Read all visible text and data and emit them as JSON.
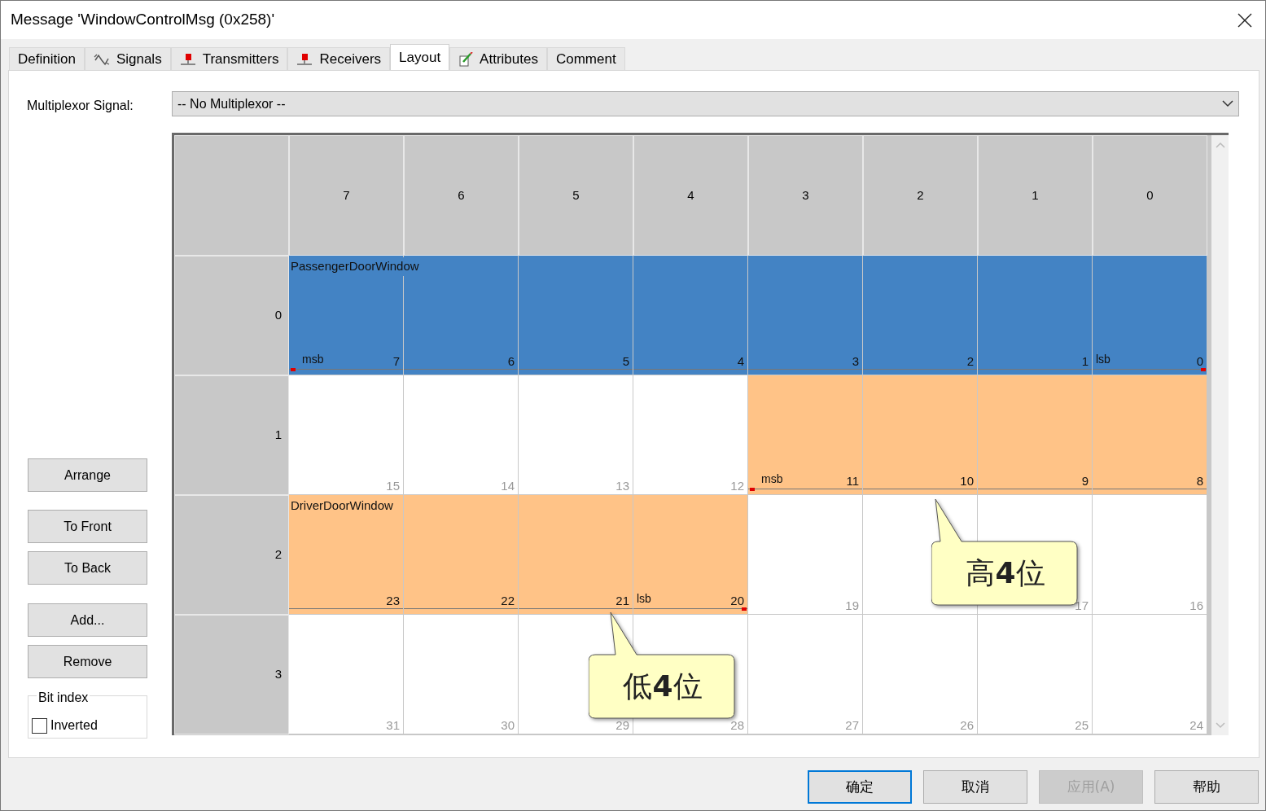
{
  "window": {
    "title": "Message 'WindowControlMsg (0x258)'"
  },
  "tabs": [
    {
      "label": "Definition",
      "kind": "plain",
      "selected": false
    },
    {
      "label": "Signals",
      "kind": "wave",
      "selected": false
    },
    {
      "label": "Transmitters",
      "kind": "node",
      "selected": false
    },
    {
      "label": "Receivers",
      "kind": "node",
      "selected": false
    },
    {
      "label": "Layout",
      "kind": "plain",
      "selected": true
    },
    {
      "label": "Attributes",
      "kind": "pencil",
      "selected": false
    },
    {
      "label": "Comment",
      "kind": "plain",
      "selected": false
    }
  ],
  "multiplexor": {
    "label": "Multiplexor Signal:",
    "value": "-- No Multiplexor --"
  },
  "side_buttons": [
    "Arrange",
    "To Front",
    "To Back",
    "Add...",
    "Remove"
  ],
  "bit_index": {
    "title": "Bit index",
    "inverted": {
      "label": "Inverted",
      "checked": false
    }
  },
  "columns": [
    "7",
    "6",
    "5",
    "4",
    "3",
    "2",
    "1",
    "0"
  ],
  "rows": [
    {
      "label": "0",
      "cells": [
        {
          "bit": "7",
          "color": "#4383c4",
          "name": "PassengerDoorWindow",
          "tag": "msb"
        },
        {
          "bit": "6",
          "color": "#4383c4"
        },
        {
          "bit": "5",
          "color": "#4383c4"
        },
        {
          "bit": "4",
          "color": "#4383c4"
        },
        {
          "bit": "3",
          "color": "#4383c4"
        },
        {
          "bit": "2",
          "color": "#4383c4"
        },
        {
          "bit": "1",
          "color": "#4383c4"
        },
        {
          "bit": "0",
          "color": "#4383c4",
          "tag": "lsb"
        }
      ]
    },
    {
      "label": "1",
      "cells": [
        {
          "bit": "15"
        },
        {
          "bit": "14"
        },
        {
          "bit": "13"
        },
        {
          "bit": "12"
        },
        {
          "bit": "11",
          "color": "#ffc387",
          "tag": "msb"
        },
        {
          "bit": "10",
          "color": "#ffc387"
        },
        {
          "bit": "9",
          "color": "#ffc387"
        },
        {
          "bit": "8",
          "color": "#ffc387"
        }
      ]
    },
    {
      "label": "2",
      "cells": [
        {
          "bit": "23",
          "color": "#ffc387",
          "name": "DriverDoorWindow"
        },
        {
          "bit": "22",
          "color": "#ffc387"
        },
        {
          "bit": "21",
          "color": "#ffc387"
        },
        {
          "bit": "20",
          "color": "#ffc387",
          "tag": "lsb"
        },
        {
          "bit": "19"
        },
        {},
        {
          "bit": "17"
        },
        {
          "bit": "16"
        }
      ]
    },
    {
      "label": "3",
      "cells": [
        {
          "bit": "31"
        },
        {
          "bit": "30"
        },
        {
          "bit": "29"
        },
        {
          "bit": "28"
        },
        {
          "bit": "27"
        },
        {
          "bit": "26"
        },
        {
          "bit": "25"
        },
        {
          "bit": "24"
        }
      ]
    }
  ],
  "callouts": [
    {
      "text": "高**4**位"
    },
    {
      "text": "低**4**位"
    }
  ],
  "buttons": [
    {
      "label": "确定",
      "default": true,
      "disabled": false
    },
    {
      "label": "取消",
      "default": false,
      "disabled": false
    },
    {
      "label": "应用(A)",
      "default": false,
      "disabled": true
    },
    {
      "label": "帮助",
      "default": false,
      "disabled": false
    }
  ]
}
